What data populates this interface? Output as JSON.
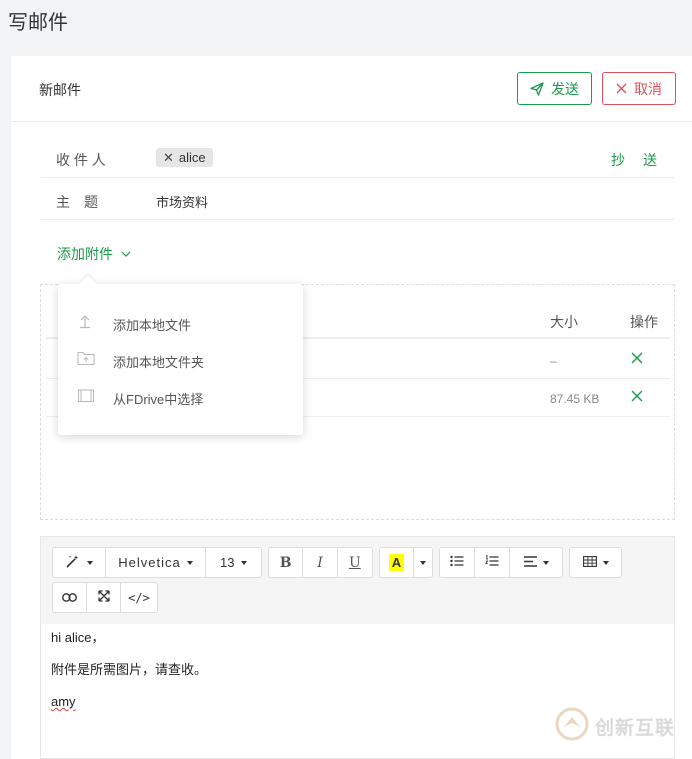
{
  "page": {
    "title": "写邮件"
  },
  "compose": {
    "header_title": "新邮件",
    "send_label": "发送",
    "cancel_label": "取消"
  },
  "to": {
    "label": "收 件 人",
    "recipient": "alice",
    "cc_label": "抄",
    "bcc_label": "送"
  },
  "subject": {
    "label": "主　题",
    "value": "市场资料"
  },
  "attachments": {
    "trigger_label": "添加附件",
    "col_size": "大小",
    "col_action": "操作",
    "rows": [
      {
        "size": "–"
      },
      {
        "size": "87.45 KB"
      }
    ]
  },
  "attach_menu": {
    "items": [
      {
        "label": "添加本地文件",
        "icon": "upload-icon"
      },
      {
        "label": "添加本地文件夹",
        "icon": "folder-upload-icon"
      },
      {
        "label": "从FDrive中选择",
        "icon": "fdrive-icon"
      }
    ]
  },
  "editor": {
    "font_family": "Helvetica",
    "font_size": "13",
    "body": {
      "line1": "hi alice，",
      "line2": "附件是所需图片，请查收。",
      "line3": "amy"
    }
  },
  "watermark": {
    "text": "创新互联"
  },
  "colors": {
    "accent": "#1a9b4b",
    "danger": "#e0505c"
  }
}
